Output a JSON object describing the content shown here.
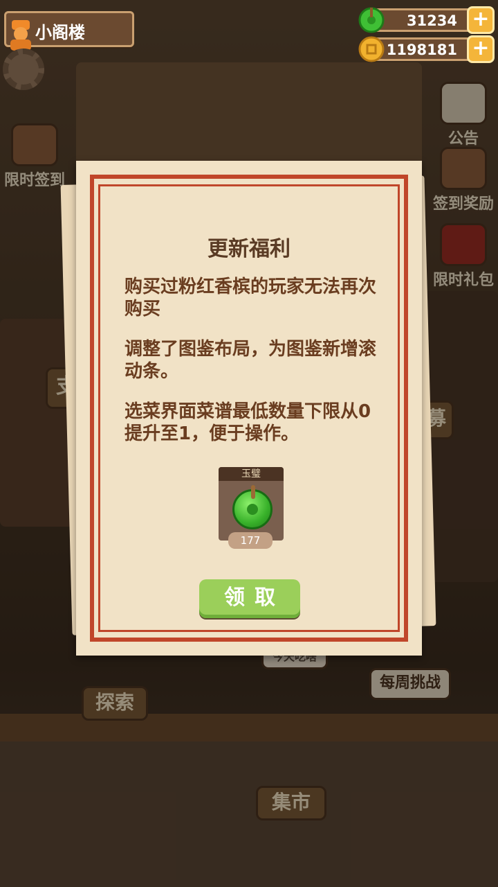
{
  "header": {
    "location_title": "小阁楼",
    "jade_count": "31234",
    "coin_count": "1198181"
  },
  "side_left": [
    "限时签到"
  ],
  "side_right": [
    "公告",
    "签到奖励",
    "限时礼包"
  ],
  "background_labels": {
    "explore": "探索",
    "market": "集市",
    "weekly_challenge": "每周挑战",
    "today_eat": "今天吃啥",
    "pay": "支",
    "recruit": "募"
  },
  "popup": {
    "title": "更新福利",
    "paragraphs": [
      "购买过粉红香槟的玩家无法再次购买",
      "调整了图鉴布局，为图鉴新增滚动条。",
      "选菜界面菜谱最低数量下限从0提升至1，便于操作。"
    ],
    "reward": {
      "name": "玉璧",
      "count": "177",
      "icon": "jade-disc-icon"
    },
    "claim_label": "领取"
  },
  "colors": {
    "frame_red": "#c0462a",
    "paper": "#f1e2c6",
    "claim_green": "#9bcf5a",
    "text_brown": "#6a3d20"
  }
}
